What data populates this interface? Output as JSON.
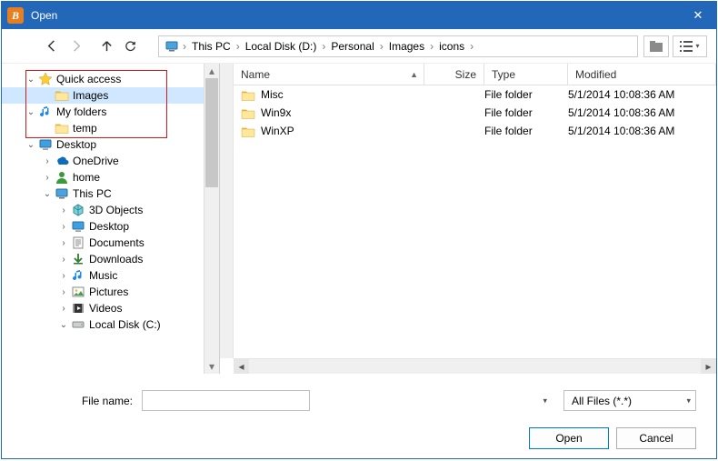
{
  "dialog": {
    "title": "Open",
    "app_glyph": "B"
  },
  "breadcrumb": {
    "segments": [
      "This PC",
      "Local Disk (D:)",
      "Personal",
      "Images",
      "icons"
    ]
  },
  "tree": [
    {
      "indent": 0,
      "toggle": "open",
      "icon": "star",
      "label": "Quick access"
    },
    {
      "indent": 1,
      "toggle": "none",
      "icon": "folder",
      "label": "Images",
      "selected": true
    },
    {
      "indent": 0,
      "toggle": "open",
      "icon": "music",
      "label": "My folders"
    },
    {
      "indent": 1,
      "toggle": "none",
      "icon": "folder",
      "label": "temp"
    },
    {
      "indent": 0,
      "toggle": "open",
      "icon": "desktop",
      "label": "Desktop"
    },
    {
      "indent": 1,
      "toggle": "closed",
      "icon": "onedrive",
      "label": "OneDrive"
    },
    {
      "indent": 1,
      "toggle": "closed",
      "icon": "user",
      "label": "home"
    },
    {
      "indent": 1,
      "toggle": "open",
      "icon": "thispc",
      "label": "This PC"
    },
    {
      "indent": 2,
      "toggle": "closed",
      "icon": "3dobj",
      "label": "3D Objects"
    },
    {
      "indent": 2,
      "toggle": "closed",
      "icon": "desktop",
      "label": "Desktop"
    },
    {
      "indent": 2,
      "toggle": "closed",
      "icon": "docs",
      "label": "Documents"
    },
    {
      "indent": 2,
      "toggle": "closed",
      "icon": "down",
      "label": "Downloads"
    },
    {
      "indent": 2,
      "toggle": "closed",
      "icon": "music",
      "label": "Music"
    },
    {
      "indent": 2,
      "toggle": "closed",
      "icon": "pics",
      "label": "Pictures"
    },
    {
      "indent": 2,
      "toggle": "closed",
      "icon": "video",
      "label": "Videos"
    },
    {
      "indent": 2,
      "toggle": "open",
      "icon": "drive",
      "label": "Local Disk (C:)"
    }
  ],
  "list": {
    "columns": {
      "name": "Name",
      "size": "Size",
      "type": "Type",
      "modified": "Modified"
    },
    "sort_column": "name",
    "rows": [
      {
        "name": "Misc",
        "size": "",
        "type": "File folder",
        "modified": "5/1/2014 10:08:36 AM"
      },
      {
        "name": "Win9x",
        "size": "",
        "type": "File folder",
        "modified": "5/1/2014 10:08:36 AM"
      },
      {
        "name": "WinXP",
        "size": "",
        "type": "File folder",
        "modified": "5/1/2014 10:08:36 AM"
      }
    ]
  },
  "bottom": {
    "filename_label": "File name:",
    "filename_value": "",
    "filter_label": "All Files (*.*)",
    "open": "Open",
    "cancel": "Cancel"
  }
}
